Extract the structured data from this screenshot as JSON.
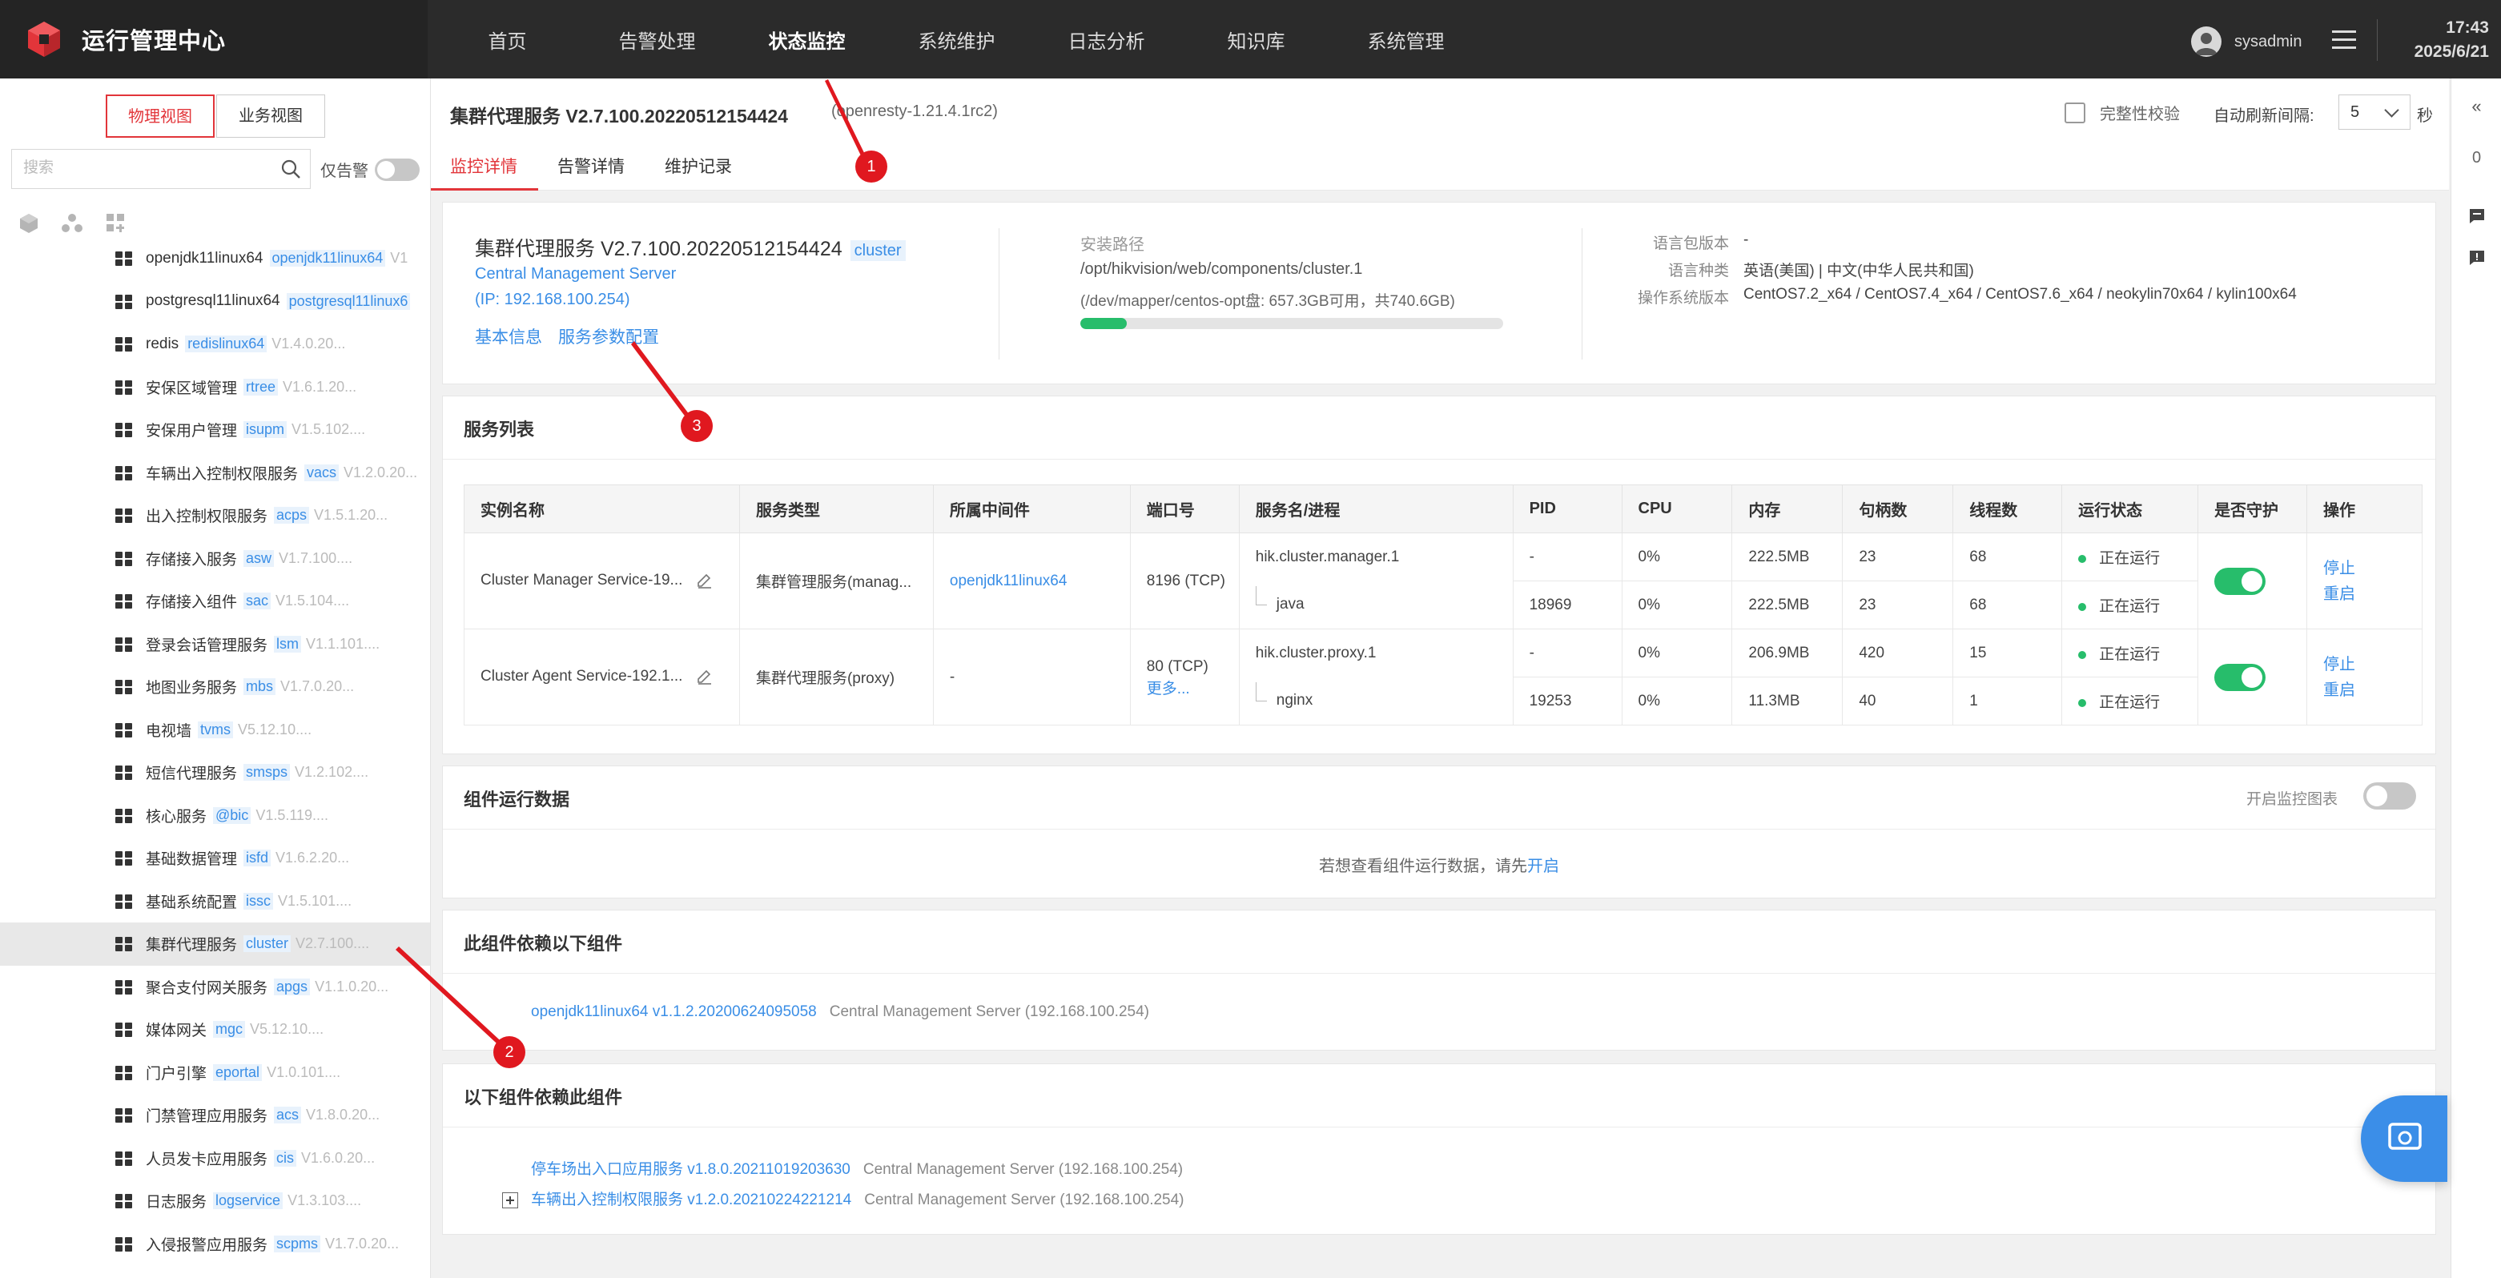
{
  "app": {
    "title": "运行管理中心",
    "user": "sysadmin",
    "time": "17:43",
    "date": "2025/6/21"
  },
  "nav": [
    "首页",
    "告警处理",
    "状态监控",
    "系统维护",
    "日志分析",
    "知识库",
    "系统管理"
  ],
  "sidebar": {
    "views": [
      "物理视图",
      "业务视图"
    ],
    "search_placeholder": "搜索",
    "alarm_only_label": "仅告警",
    "items": [
      {
        "name": "openjdk11linux64",
        "tag": "openjdk11linux64",
        "ver": "V1"
      },
      {
        "name": "postgresql11linux64",
        "tag": "postgresql11linux6",
        "ver": ""
      },
      {
        "name": "redis",
        "tag": "redislinux64",
        "ver": "V1.4.0.20..."
      },
      {
        "name": "安保区域管理",
        "tag": "rtree",
        "ver": "V1.6.1.20..."
      },
      {
        "name": "安保用户管理",
        "tag": "isupm",
        "ver": "V1.5.102...."
      },
      {
        "name": "车辆出入控制权限服务",
        "tag": "vacs",
        "ver": "V1.2.0.20..."
      },
      {
        "name": "出入控制权限服务",
        "tag": "acps",
        "ver": "V1.5.1.20..."
      },
      {
        "name": "存储接入服务",
        "tag": "asw",
        "ver": "V1.7.100...."
      },
      {
        "name": "存储接入组件",
        "tag": "sac",
        "ver": "V1.5.104...."
      },
      {
        "name": "登录会话管理服务",
        "tag": "lsm",
        "ver": "V1.1.101...."
      },
      {
        "name": "地图业务服务",
        "tag": "mbs",
        "ver": "V1.7.0.20..."
      },
      {
        "name": "电视墙",
        "tag": "tvms",
        "ver": "V5.12.10...."
      },
      {
        "name": "短信代理服务",
        "tag": "smsps",
        "ver": "V1.2.102...."
      },
      {
        "name": "核心服务",
        "tag": "@bic",
        "ver": "V1.5.119...."
      },
      {
        "name": "基础数据管理",
        "tag": "isfd",
        "ver": "V1.6.2.20..."
      },
      {
        "name": "基础系统配置",
        "tag": "issc",
        "ver": "V1.5.101...."
      },
      {
        "name": "集群代理服务",
        "tag": "cluster",
        "ver": "V2.7.100...."
      },
      {
        "name": "聚合支付网关服务",
        "tag": "apgs",
        "ver": "V1.1.0.20..."
      },
      {
        "name": "媒体网关",
        "tag": "mgc",
        "ver": "V5.12.10...."
      },
      {
        "name": "门户引擎",
        "tag": "eportal",
        "ver": "V1.0.101...."
      },
      {
        "name": "门禁管理应用服务",
        "tag": "acs",
        "ver": "V1.8.0.20..."
      },
      {
        "name": "人员发卡应用服务",
        "tag": "cis",
        "ver": "V1.6.0.20..."
      },
      {
        "name": "日志服务",
        "tag": "logservice",
        "ver": "V1.3.103...."
      },
      {
        "name": "入侵报警应用服务",
        "tag": "scpms",
        "ver": "V1.7.0.20..."
      }
    ]
  },
  "header": {
    "title": "集群代理服务 V2.7.100.20220512154424",
    "subtitle": "(openresty-1.21.4.1rc2)",
    "integrity": "完整性校验",
    "refresh_label": "自动刷新间隔:",
    "refresh_value": "5",
    "refresh_unit": "秒",
    "tabs": [
      "监控详情",
      "告警详情",
      "维护记录"
    ]
  },
  "info": {
    "name": "集群代理服务 V2.7.100.20220512154424",
    "tag": "cluster",
    "server": "Central Management Server",
    "ip": "(IP: 192.168.100.254)",
    "link_basic": "基本信息",
    "link_params": "服务参数配置",
    "install_path_label": "安装路径",
    "install_path": "/opt/hikvision/web/components/cluster.1",
    "disk": "(/dev/mapper/centos-opt盘: 657.3GB可用，共740.6GB)",
    "disk_used_fraction": 0.11,
    "lang_pkg_label": "语言包版本",
    "lang_pkg": "-",
    "lang_label": "语言种类",
    "lang": "英语(美国) | 中文(中华人民共和国)",
    "os_label": "操作系统版本",
    "os": "CentOS7.2_x64 / CentOS7.4_x64 / CentOS7.6_x64 / neokylin70x64 / kylin100x64"
  },
  "services": {
    "title": "服务列表",
    "columns": [
      "实例名称",
      "服务类型",
      "所属中间件",
      "端口号",
      "服务名/进程",
      "PID",
      "CPU",
      "内存",
      "句柄数",
      "线程数",
      "运行状态",
      "是否守护",
      "操作"
    ],
    "rows": [
      {
        "instance": "Cluster Manager Service-19...",
        "type": "集群管理服务(manag...",
        "middleware": "openjdk11linux64",
        "port": "8196 (TCP)",
        "port_more": "",
        "procs": [
          {
            "name": "hik.cluster.manager.1",
            "pid": "-",
            "cpu": "0%",
            "mem": "222.5MB",
            "handles": "23",
            "threads": "68",
            "status": "正在运行"
          },
          {
            "name": "java",
            "pid": "18969",
            "cpu": "0%",
            "mem": "222.5MB",
            "handles": "23",
            "threads": "68",
            "status": "正在运行"
          }
        ],
        "guard": true,
        "ops": [
          "停止",
          "重启"
        ]
      },
      {
        "instance": "Cluster Agent Service-192.1...",
        "type": "集群代理服务(proxy)",
        "middleware": "-",
        "port": "80 (TCP)",
        "port_more": "更多...",
        "procs": [
          {
            "name": "hik.cluster.proxy.1",
            "pid": "-",
            "cpu": "0%",
            "mem": "206.9MB",
            "handles": "420",
            "threads": "15",
            "status": "正在运行"
          },
          {
            "name": "nginx",
            "pid": "19253",
            "cpu": "0%",
            "mem": "11.3MB",
            "handles": "40",
            "threads": "1",
            "status": "正在运行"
          }
        ],
        "guard": true,
        "ops": [
          "停止",
          "重启"
        ]
      }
    ]
  },
  "runtime": {
    "title": "组件运行数据",
    "toggle_label": "开启监控图表",
    "hint_prefix": "若想查看组件运行数据，请先",
    "hint_link": "开启"
  },
  "depends_on": {
    "title": "此组件依赖以下组件",
    "items": [
      {
        "name": "openjdk11linux64 v1.1.2.20200624095058",
        "server": "Central Management Server (192.168.100.254)"
      }
    ]
  },
  "depended_by": {
    "title": "以下组件依赖此组件",
    "items": [
      {
        "name": "停车场出入口应用服务 v1.8.0.20211019203630",
        "server": "Central Management Server (192.168.100.254)",
        "expandable": false
      },
      {
        "name": "车辆出入控制权限服务 v1.2.0.20210224221214",
        "server": "Central Management Server (192.168.100.254)",
        "expandable": true
      }
    ]
  },
  "rail": {
    "badge": "0"
  },
  "annotations": [
    "1",
    "2",
    "3"
  ],
  "colors": {
    "accent": "#e2353a",
    "link": "#3a8ee6",
    "success": "#27bd6b",
    "topbar": "#2b2b2b"
  }
}
